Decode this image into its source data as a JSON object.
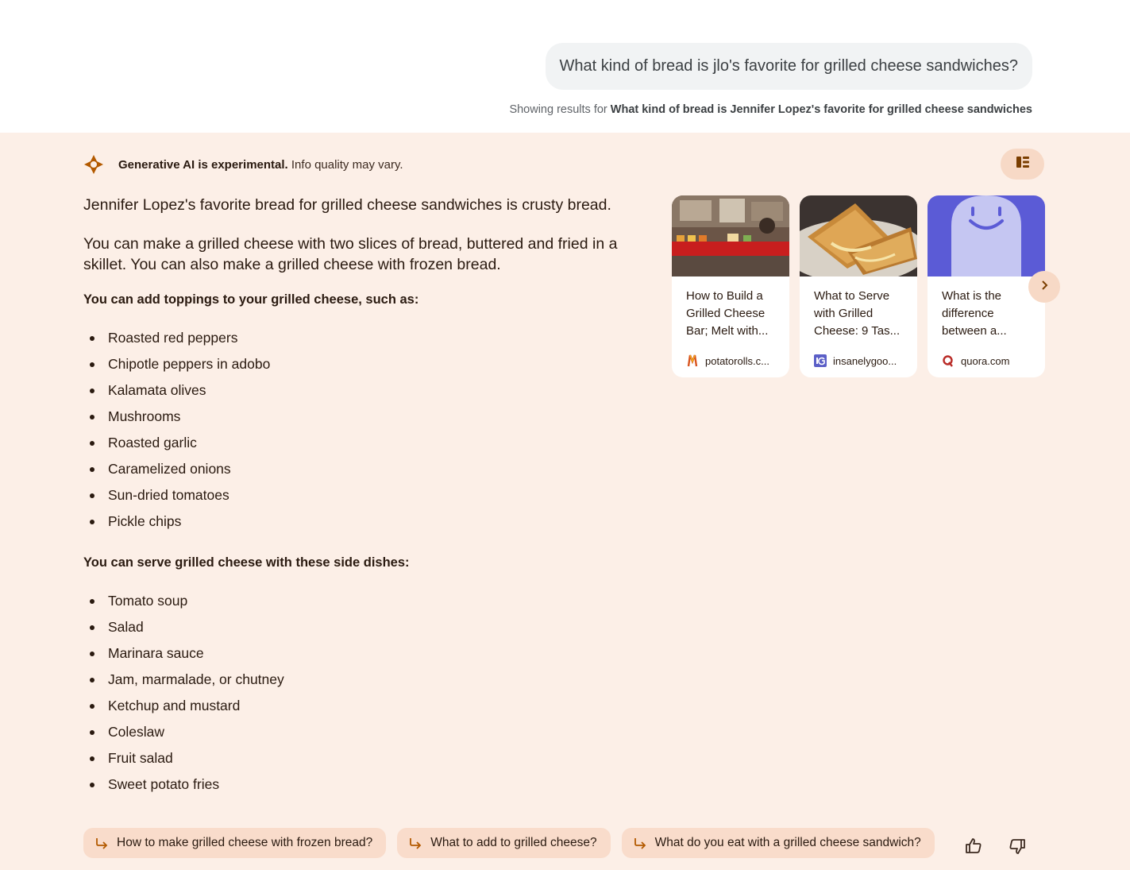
{
  "query": {
    "text": "What kind of bread is jlo's favorite for grilled cheese sandwiches?",
    "showing_prefix": "Showing results for ",
    "showing_corrected": "What kind of bread is Jennifer Lopez's favorite for grilled cheese sandwiches"
  },
  "ai_header": {
    "bold": "Generative AI is experimental.",
    "rest": " Info quality may vary."
  },
  "answer": {
    "para1": "Jennifer Lopez's favorite bread for grilled cheese sandwiches is crusty bread.",
    "para2": "You can make a grilled cheese with two slices of bread, buttered and fried in a skillet. You can also make a grilled cheese with frozen bread.",
    "toppings_heading": "You can add toppings to your grilled cheese, such as:",
    "toppings": [
      "Roasted red peppers",
      "Chipotle peppers in adobo",
      "Kalamata olives",
      "Mushrooms",
      "Roasted garlic",
      "Caramelized onions",
      "Sun-dried tomatoes",
      "Pickle chips"
    ],
    "sides_heading": "You can serve grilled cheese with these side dishes:",
    "sides": [
      "Tomato soup",
      "Salad",
      "Marinara sauce",
      "Jam, marmalade, or chutney",
      "Ketchup and mustard",
      "Coleslaw",
      "Fruit salad",
      "Sweet potato fries"
    ]
  },
  "cards": [
    {
      "title": "How to Build a Grilled Cheese Bar; Melt with...",
      "source": "potatorolls.c..."
    },
    {
      "title": "What to Serve with Grilled Cheese: 9 Tas...",
      "source": "insanelygoo..."
    },
    {
      "title": "What is the difference between a...",
      "source": "quora.com"
    }
  ],
  "chips": [
    "How to make grilled cheese with frozen bread?",
    "What to add to grilled cheese?",
    "What do you eat with a grilled cheese sandwich?"
  ],
  "colors": {
    "panel_bg": "#fcefe7",
    "chip_bg": "#f9dccb",
    "accent": "#b35a00"
  }
}
